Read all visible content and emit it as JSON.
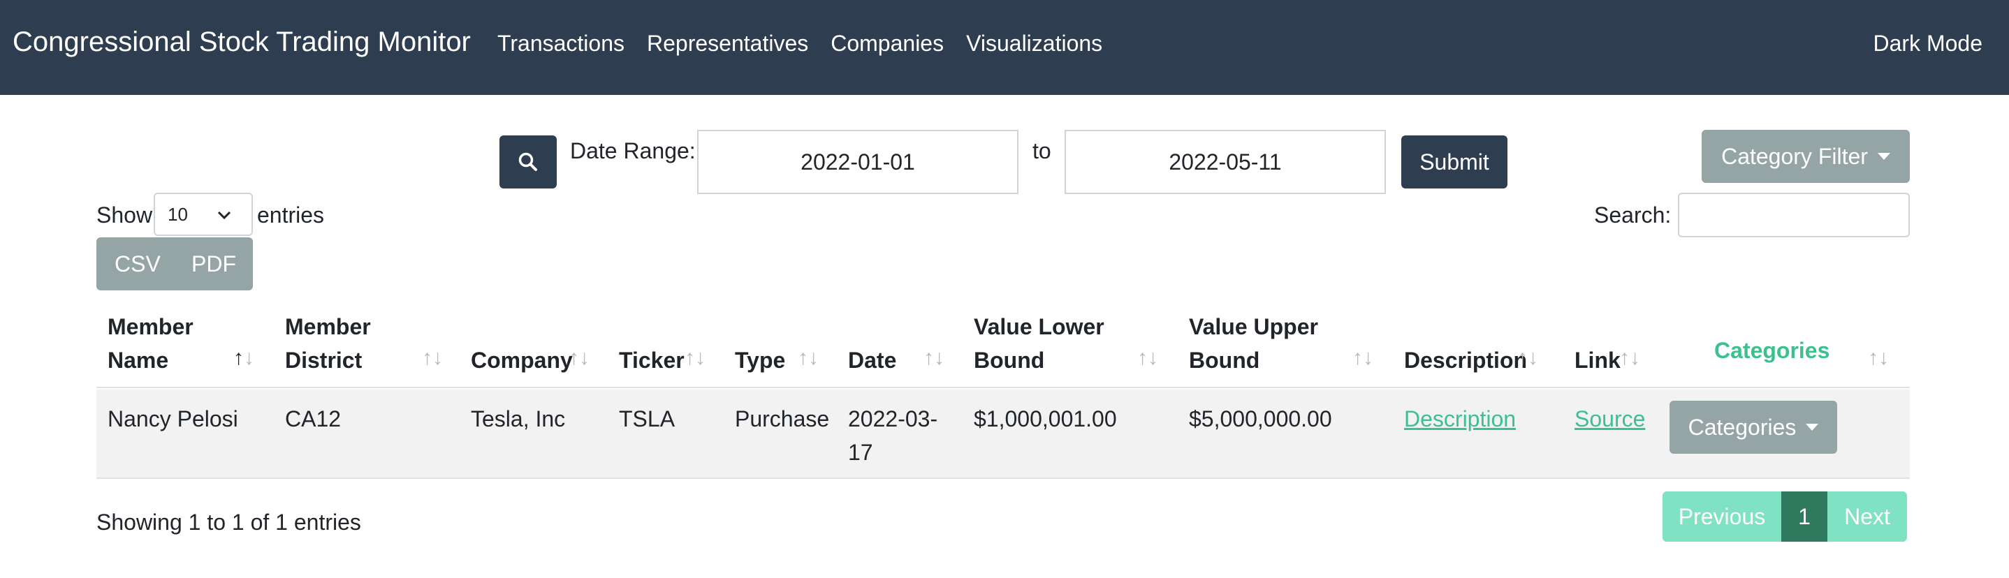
{
  "navbar": {
    "brand": "Congressional Stock Trading Monitor",
    "links": [
      "Transactions",
      "Representatives",
      "Companies",
      "Visualizations"
    ],
    "dark_mode": "Dark Mode"
  },
  "filters": {
    "search_icon": "search-icon",
    "date_range_label": "Date Range:",
    "start_date": "2022-01-01",
    "to_label": "to",
    "end_date": "2022-05-11",
    "submit_label": "Submit",
    "category_filter_label": "Category Filter"
  },
  "controls": {
    "show_label": "Show",
    "entries_value": "10",
    "entries_label": "entries",
    "search_label": "Search:",
    "search_value": "",
    "csv_label": "CSV",
    "pdf_label": "PDF"
  },
  "table": {
    "headers": {
      "member_name": [
        "Member",
        "Name"
      ],
      "member_district": [
        "Member",
        "District"
      ],
      "company": "Company",
      "ticker": "Ticker",
      "type": "Type",
      "date": "Date",
      "value_lower": [
        "Value Lower",
        "Bound"
      ],
      "value_upper": [
        "Value Upper",
        "Bound"
      ],
      "description": "Description",
      "link": "Link",
      "categories": "Categories"
    },
    "rows": [
      {
        "member_name": "Nancy Pelosi",
        "member_district": "CA12",
        "company": "Tesla, Inc",
        "ticker": "TSLA",
        "type": "Purchase",
        "date_line1": "2022-03-",
        "date_line2": "17",
        "value_lower": "$1,000,001.00",
        "value_upper": "$5,000,000.00",
        "description": "Description",
        "link": "Source",
        "categories_button": "Categories"
      }
    ]
  },
  "footer": {
    "info": "Showing 1 to 1 of 1 entries",
    "previous": "Previous",
    "current_page": "1",
    "next": "Next"
  },
  "colors": {
    "navbar": "#2e3d50",
    "accent_green": "#3ebf8f",
    "secondary_gray": "#95a5a6",
    "pager_light": "#7ee2c3",
    "pager_active": "#2f7a5e"
  }
}
